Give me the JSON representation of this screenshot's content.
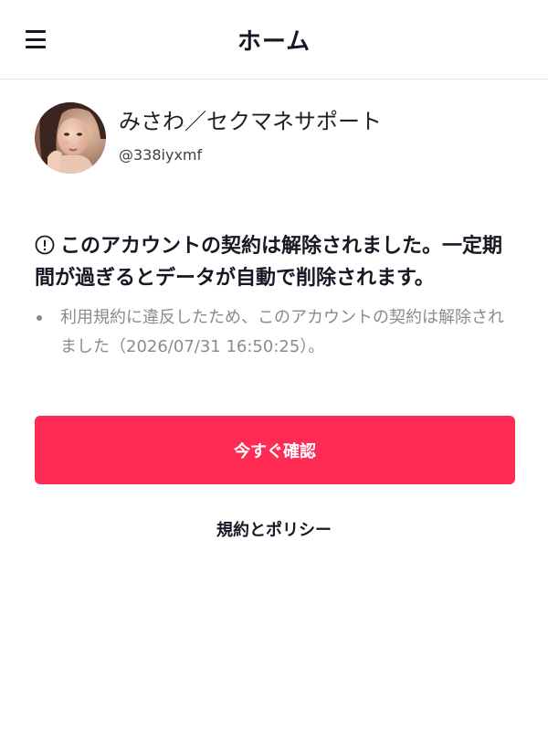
{
  "header": {
    "title": "ホーム",
    "menu_icon": "hamburger-menu-icon"
  },
  "profile": {
    "display_name": "みさわ／セクマネサポート",
    "username": "@338iyxmf"
  },
  "notice": {
    "icon": "alert-circle-icon",
    "title": "このアカウントの契約は解除されました。一定期間が過ぎるとデータが自動で削除されます。",
    "details": [
      "利用規約に違反したため、このアカウントの契約は解除されました（2026/07/31 16:50:25）。"
    ]
  },
  "actions": {
    "confirm_label": "今すぐ確認",
    "policy_label": "規約とポリシー"
  },
  "colors": {
    "accent": "#fe2c55",
    "text_primary": "#161823",
    "text_secondary": "#8a8b91"
  }
}
